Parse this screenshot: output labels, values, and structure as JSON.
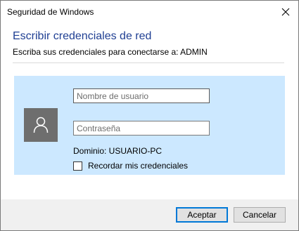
{
  "window": {
    "title": "Seguridad de Windows"
  },
  "dialog": {
    "heading": "Escribir credenciales de red",
    "subheading": "Escriba sus credenciales para conectarse a: ADMIN"
  },
  "credentials": {
    "username_placeholder": "Nombre de usuario",
    "username_value": "",
    "password_placeholder": "Contraseña",
    "password_value": "",
    "domain_text": "Dominio: USUARIO-PC",
    "remember_label": "Recordar mis credenciales",
    "remember_checked": false,
    "avatar_icon": "user-icon"
  },
  "buttons": {
    "accept_label": "Aceptar",
    "cancel_label": "Cancelar"
  },
  "colors": {
    "heading": "#1f3f93",
    "panel_bg": "#cce8ff",
    "avatar_bg": "#6e6e6e",
    "primary_border": "#0078d7",
    "footer_bg": "#f0f0f0"
  }
}
